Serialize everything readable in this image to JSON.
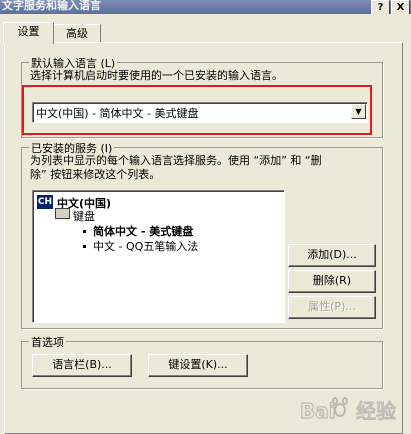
{
  "window": {
    "title": "文字服务和输入语言",
    "help_button": "?",
    "close_button": "X"
  },
  "tabs": [
    {
      "label": "设置"
    },
    {
      "label": "高级"
    }
  ],
  "default_language": {
    "group_label": "默认输入语言 (L)",
    "description": "选择计算机启动时要使用的一个已安装的输入语言。",
    "selected": "中文(中国) - 简体中文 - 美式键盘"
  },
  "installed_services": {
    "group_label": "已安装的服务 (I)",
    "description_line1": "为列表中显示的每个输入语言选择服务。使用 “添加” 和 “删",
    "description_line2": "除” 按钮来修改这个列表。",
    "tree": {
      "language": "中文(中国)",
      "language_icon": "CH",
      "category": "键盘",
      "items": [
        "简体中文 - 美式键盘",
        "中文 - QQ五笔输入法"
      ]
    },
    "buttons": {
      "add": "添加(D)...",
      "remove": "删除(R)",
      "properties": "属性(P)..."
    }
  },
  "preferences": {
    "group_label": "首选项",
    "language_bar": "语言栏(B)...",
    "key_settings": "键设置(K)..."
  },
  "watermark": "Bai 经验"
}
